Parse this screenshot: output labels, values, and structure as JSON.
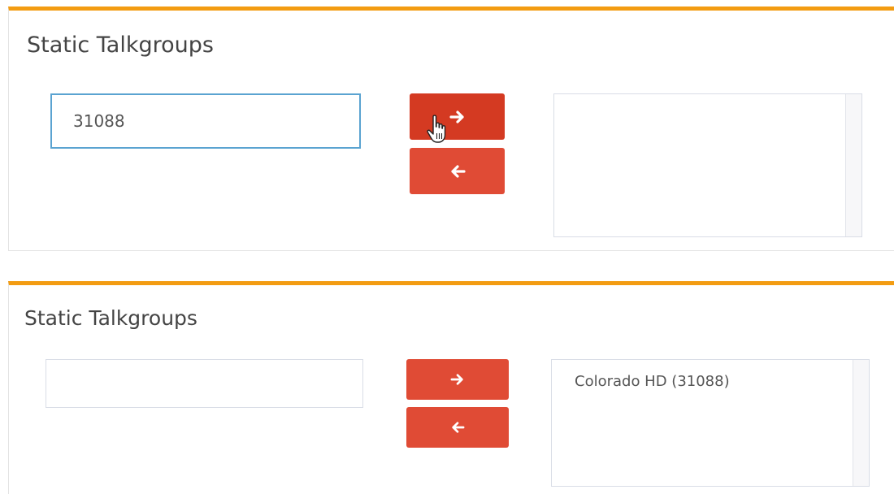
{
  "before": {
    "title": "Static Talkgroups",
    "input_value": "31088",
    "add_icon": "arrow-right-icon",
    "remove_icon": "arrow-left-icon",
    "selected_items": []
  },
  "after": {
    "title": "Static Talkgroups",
    "input_value": "",
    "add_icon": "arrow-right-icon",
    "remove_icon": "arrow-left-icon",
    "selected_items": [
      "Colorado HD (31088)"
    ]
  },
  "cursor_icon": "hand-pointer-icon",
  "colors": {
    "panel_top_border": "#f39c12",
    "button_red": "#e04b35",
    "button_red_active": "#d43a22",
    "input_focus_border": "#5aa3d1"
  }
}
